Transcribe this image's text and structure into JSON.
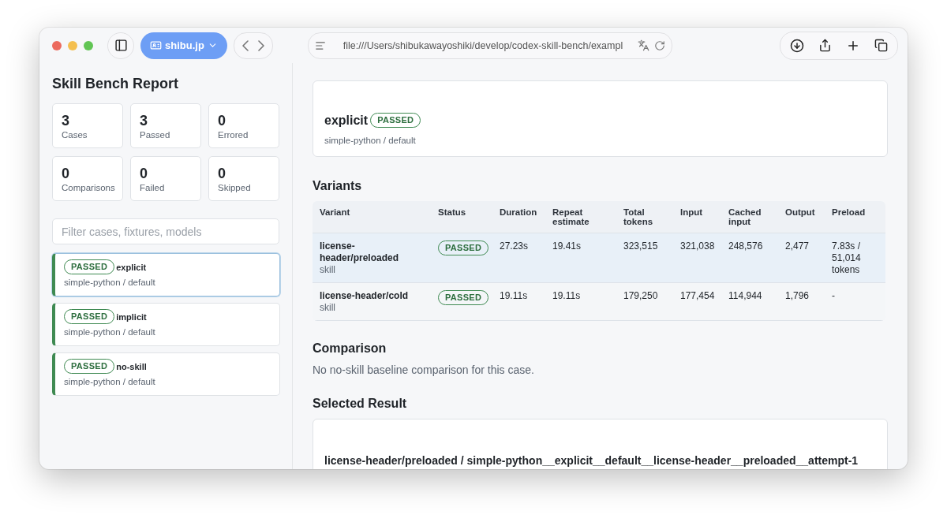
{
  "browser": {
    "profile": "shibu.jp",
    "url": "file:///Users/shibukawayoshiki/develop/codex-skill-bench/exampl"
  },
  "sidebar": {
    "title": "Skill Bench Report",
    "stats": [
      {
        "value": "3",
        "label": "Cases"
      },
      {
        "value": "3",
        "label": "Passed"
      },
      {
        "value": "0",
        "label": "Errored"
      },
      {
        "value": "0",
        "label": "Comparisons"
      },
      {
        "value": "0",
        "label": "Failed"
      },
      {
        "value": "0",
        "label": "Skipped"
      }
    ],
    "filter": {
      "placeholder": "Filter cases, fixtures, models"
    },
    "cases": [
      {
        "badge": {
          "label": "PASSED",
          "kind": "passed"
        },
        "name": "explicit",
        "subtitle": "simple-python / default",
        "selected": true
      },
      {
        "badge": {
          "label": "PASSED",
          "kind": "passed"
        },
        "name": "implicit",
        "subtitle": "simple-python / default",
        "selected": false
      },
      {
        "badge": {
          "label": "PASSED",
          "kind": "passed"
        },
        "name": "no-skill",
        "subtitle": "simple-python / default",
        "selected": false
      }
    ]
  },
  "detail": {
    "title": "explicit",
    "badge": {
      "label": "PASSED",
      "kind": "passed"
    },
    "subtitle": "simple-python / default"
  },
  "variants": {
    "heading": "Variants",
    "columns": [
      "Variant",
      "Status",
      "Duration",
      "Repeat estimate",
      "Total tokens",
      "Input",
      "Cached input",
      "Output",
      "Preload"
    ],
    "rows": [
      {
        "cells": [
          {
            "name": "license-header/preloaded",
            "type": "skill"
          },
          {
            "label": "PASSED",
            "kind": "passed"
          },
          "27.23s",
          "19.41s",
          "323,515",
          "321,038",
          "248,576",
          "2,477",
          "7.83s / 51,014 tokens"
        ],
        "selected": true
      },
      {
        "cells": [
          {
            "name": "license-header/cold",
            "type": "skill"
          },
          {
            "label": "PASSED",
            "kind": "passed"
          },
          "19.11s",
          "19.11s",
          "179,250",
          "177,454",
          "114,944",
          "1,796",
          "-"
        ],
        "selected": false
      }
    ]
  },
  "comparison": {
    "heading": "Comparison",
    "message": "No no-skill baseline comparison for this case."
  },
  "selected_result": {
    "heading": "Selected Result",
    "title": "license-header/preloaded / simple-python__explicit__default__license-header__preloaded__attempt-1"
  }
}
